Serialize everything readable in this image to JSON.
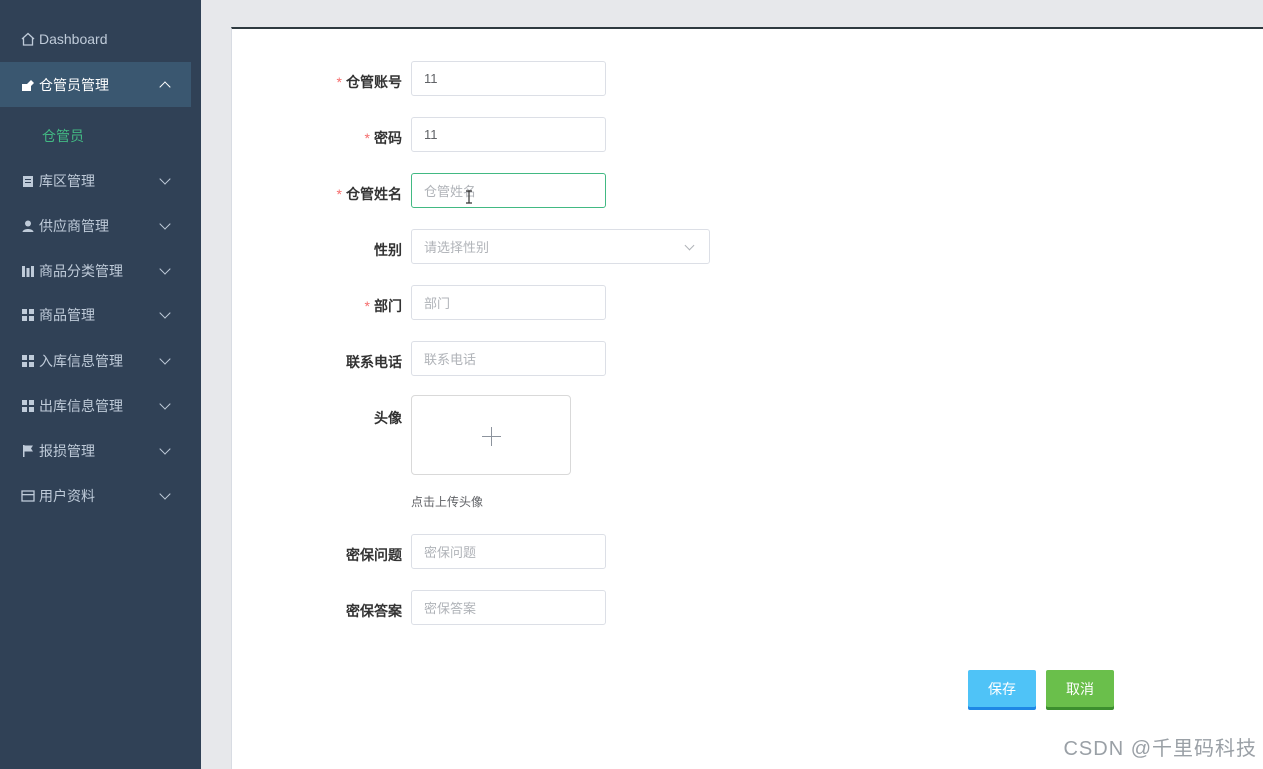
{
  "sidebar": {
    "items": [
      {
        "label": "Dashboard",
        "icon": "home-icon"
      },
      {
        "label": "仓管员管理",
        "icon": "users-icon",
        "expanded": true
      },
      {
        "label": "库区管理",
        "icon": "clipboard-icon"
      },
      {
        "label": "供应商管理",
        "icon": "person-icon"
      },
      {
        "label": "商品分类管理",
        "icon": "bar-chart-icon"
      },
      {
        "label": "商品管理",
        "icon": "grid-icon"
      },
      {
        "label": "入库信息管理",
        "icon": "grid-icon"
      },
      {
        "label": "出库信息管理",
        "icon": "grid-icon"
      },
      {
        "label": "报损管理",
        "icon": "flag-icon"
      },
      {
        "label": "用户资料",
        "icon": "card-icon"
      }
    ],
    "subitem": "仓管员"
  },
  "form": {
    "account": {
      "label": "仓管账号",
      "value": "11",
      "required": true
    },
    "password": {
      "label": "密码",
      "value": "11",
      "required": true
    },
    "name": {
      "label": "仓管姓名",
      "placeholder": "仓管姓名",
      "required": true
    },
    "gender": {
      "label": "性别",
      "placeholder": "请选择性别"
    },
    "department": {
      "label": "部门",
      "placeholder": "部门",
      "required": true
    },
    "phone": {
      "label": "联系电话",
      "placeholder": "联系电话"
    },
    "avatar": {
      "label": "头像",
      "hint": "点击上传头像"
    },
    "security_question": {
      "label": "密保问题",
      "placeholder": "密保问题"
    },
    "security_answer": {
      "label": "密保答案",
      "placeholder": "密保答案"
    }
  },
  "buttons": {
    "save": "保存",
    "cancel": "取消"
  },
  "watermark": "CSDN @千里码科技",
  "colors": {
    "sidebar": "#304156",
    "accent": "#42b983",
    "required": "#f56c6c",
    "save": "#4fc3f7",
    "cancel": "#6abf4b"
  }
}
